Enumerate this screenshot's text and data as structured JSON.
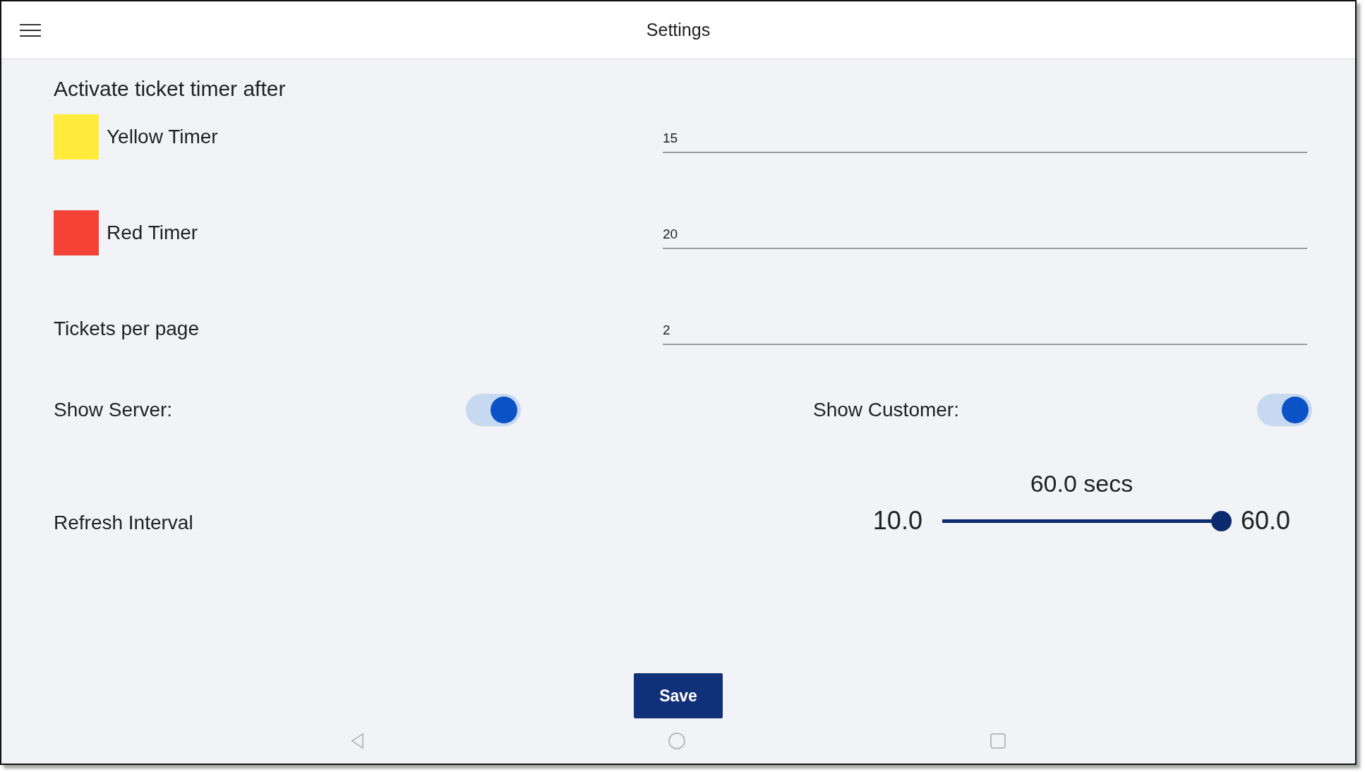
{
  "header": {
    "title": "Settings"
  },
  "timer_section": {
    "heading": "Activate ticket timer after",
    "timers": [
      {
        "label": "Yellow Timer",
        "color": "#ffeb3b",
        "value": "15"
      },
      {
        "label": "Red Timer",
        "color": "#f44336",
        "value": "20"
      }
    ]
  },
  "tickets_per_page": {
    "label": "Tickets per page",
    "value": "2"
  },
  "toggles": [
    {
      "label": "Show Server:",
      "on": true
    },
    {
      "label": "Show Customer:",
      "on": true
    }
  ],
  "refresh_interval": {
    "label": "Refresh Interval",
    "reading": "60.0 secs",
    "min_label": "10.0",
    "max_label": "60.0",
    "level": 1
  },
  "save_button": {
    "label": "Save"
  }
}
